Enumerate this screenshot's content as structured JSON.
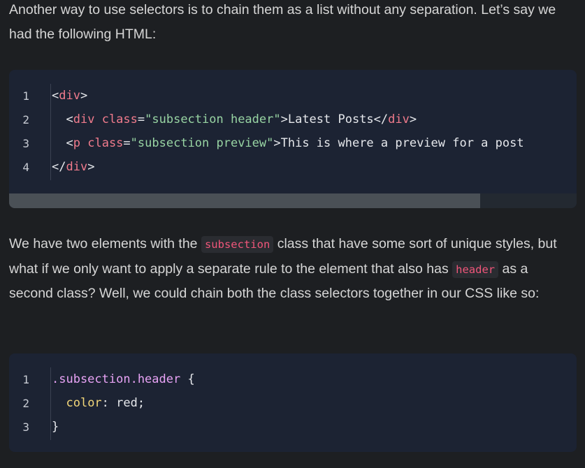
{
  "intro": {
    "text": "Another way to use selectors is to chain them as a list without any separation. Let’s say we had the following HTML:"
  },
  "html_example": {
    "line_numbers": [
      "1",
      "2",
      "3",
      "4"
    ],
    "lines": [
      [
        "",
        "<",
        "div",
        ">"
      ],
      [
        "  ",
        "<",
        "div",
        " ",
        "class",
        "=",
        "\"subsection header\"",
        ">Latest Posts</",
        "div",
        ">"
      ],
      [
        "  ",
        "<",
        "p",
        " ",
        "class",
        "=",
        "\"subsection preview\"",
        ">This is where a preview for a post"
      ],
      [
        "",
        "</",
        "div",
        ">"
      ]
    ],
    "scroll_fraction": 0.83
  },
  "explanation": {
    "part1": "We have two elements with the ",
    "code1": "subsection",
    "part2": " class that have some sort of unique styles, but what if we only want to apply a separate rule to the element that also has ",
    "code2": "header",
    "part3": " as a second class? Well, we could chain both the class selectors together in our CSS like so:"
  },
  "css_example": {
    "line_numbers": [
      "1",
      "2",
      "3"
    ],
    "selector": ".subsection.header",
    "open_brace": " {",
    "property": "color",
    "colon": ": ",
    "value": "red;",
    "close_brace": "}"
  },
  "colors": {
    "background": "#1d1f22",
    "code_background": "#1c2333",
    "tag": "#f07b8c",
    "string": "#98d4a3",
    "selector": "#e8a3f5",
    "property": "#f3d77a",
    "inline_code": "#f0567a"
  }
}
